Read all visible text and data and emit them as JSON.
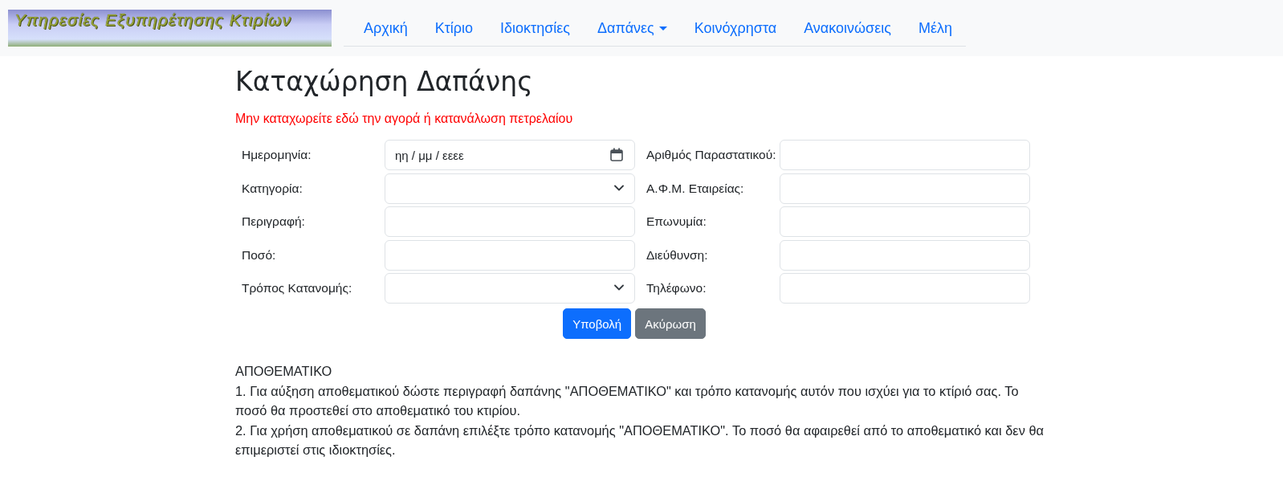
{
  "logo": {
    "text": "Υπηρεσίες Εξυπηρέτησης Κτιρίων"
  },
  "nav": [
    {
      "label": "Αρχική",
      "kind": "link"
    },
    {
      "label": "Κτίριο",
      "kind": "link"
    },
    {
      "label": "Ιδιοκτησίες",
      "kind": "link"
    },
    {
      "label": "Δαπάνες",
      "kind": "dropdown"
    },
    {
      "label": "Κοινόχρηστα",
      "kind": "link"
    },
    {
      "label": "Ανακοινώσεις",
      "kind": "link"
    },
    {
      "label": "Μέλη",
      "kind": "link"
    }
  ],
  "heading": "Καταχώρηση Δαπάνης",
  "warning": "Μην καταχωρείτε εδώ την αγορά ή κατανάλωση πετρελαίου",
  "fields": [
    {
      "label": "Ημερομηνία:",
      "kind": "date",
      "placeholder": "ηη / μμ / εεεε"
    },
    {
      "label": "Αριθμός Παραστατικού:",
      "kind": "text"
    },
    {
      "label": "Κατηγορία:",
      "kind": "select"
    },
    {
      "label": "Α.Φ.Μ. Εταιρείας:",
      "kind": "text"
    },
    {
      "label": "Περιγραφή:",
      "kind": "text"
    },
    {
      "label": "Επωνυμία:",
      "kind": "text"
    },
    {
      "label": "Ποσό:",
      "kind": "text"
    },
    {
      "label": "Διεύθυνση:",
      "kind": "text"
    },
    {
      "label": "Τρόπος Κατανομής:",
      "kind": "select"
    },
    {
      "label": "Τηλέφωνο:",
      "kind": "text"
    }
  ],
  "buttons": [
    {
      "label": "Υποβολή",
      "kind": "primary"
    },
    {
      "label": "Ακύρωση",
      "kind": "secondary"
    }
  ],
  "notes": [
    "ΑΠΟΘΕΜΑΤΙΚΟ",
    "1. Για αύξηση αποθεματικού δώστε περιγραφή δαπάνης \"ΑΠΟΘΕΜΑΤΙΚΟ\" και τρόπο κατανομής αυτόν που ισχύει για το κτίριό σας. Το ποσό θα προστεθεί στο αποθεματικό του κτιρίου.",
    "2. Για χρήση αποθεματικού σε δαπάνη επιλέξτε τρόπο κατανομής \"ΑΠΟΘΕΜΑΤΙΚΟ\". Το ποσό θα αφαιρεθεί από το αποθεματικό και δεν θα επιμεριστεί στις ιδιοκτησίες."
  ]
}
